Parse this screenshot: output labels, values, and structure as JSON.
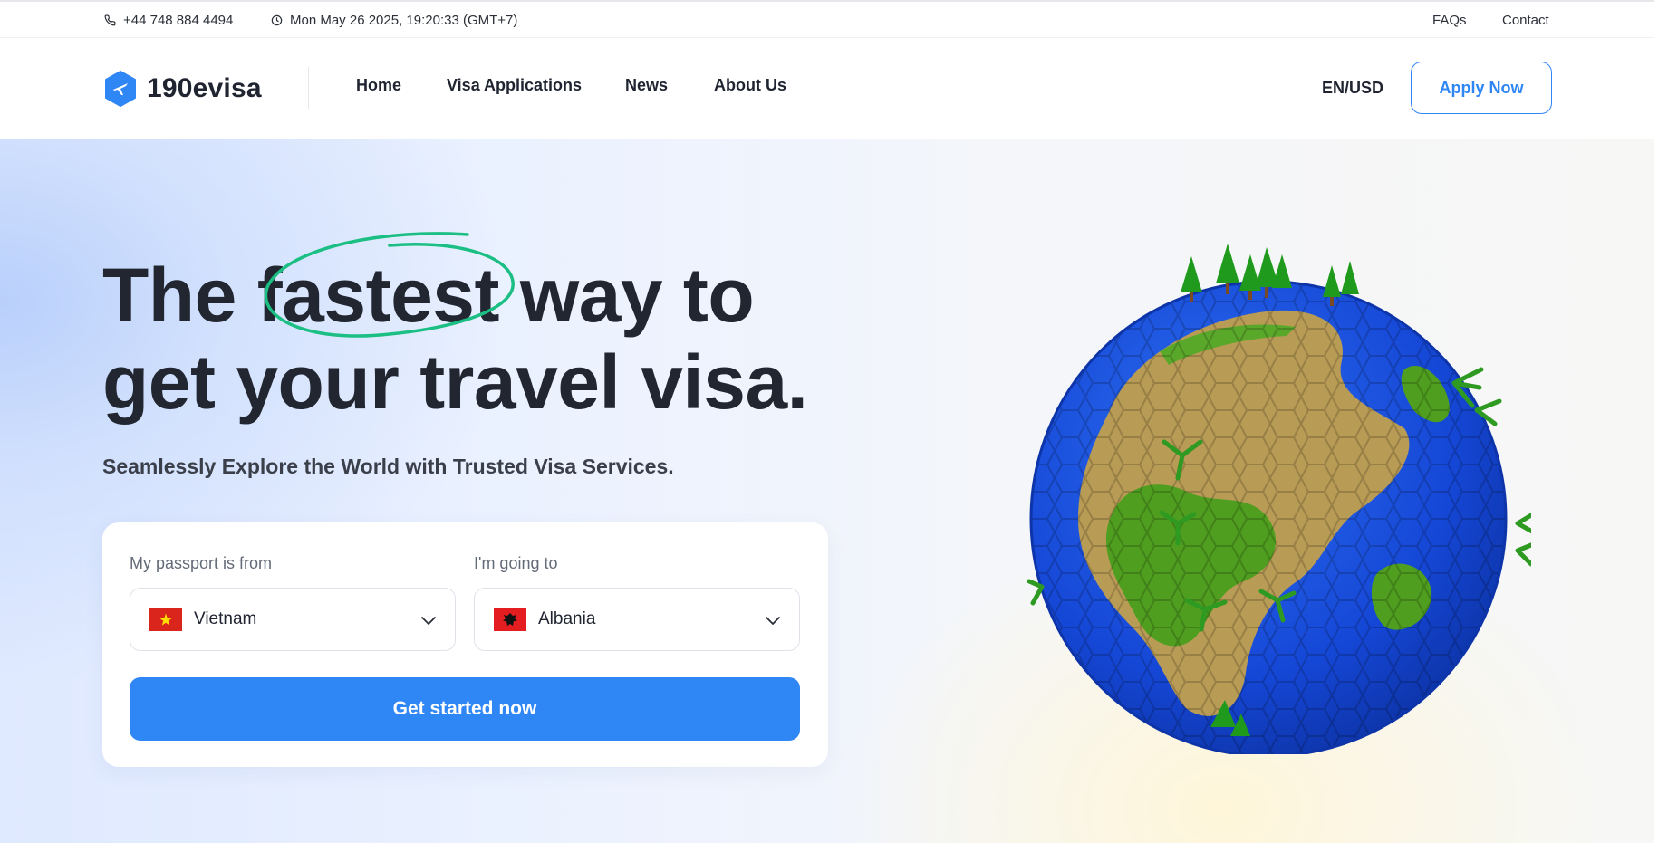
{
  "topbar": {
    "phone": "+44 748 884 4494",
    "datetime": "Mon May 26 2025, 19:20:33 (GMT+7)",
    "links": {
      "faqs": "FAQs",
      "contact": "Contact"
    }
  },
  "brand": {
    "name": "190evisa",
    "accent": "#2f86f5"
  },
  "nav": {
    "items": [
      "Home",
      "Visa Applications",
      "News",
      "About Us"
    ],
    "locale": "EN/USD",
    "apply_label": "Apply Now"
  },
  "hero": {
    "headline_part1": "The ",
    "headline_highlight": "fastest",
    "headline_part2": " way to",
    "headline_line2": "get your travel visa.",
    "subheadline": "Seamlessly Explore the World with Trusted Visa Services.",
    "highlight_color": "#1bbf83"
  },
  "form": {
    "passport_label": "My passport is from",
    "passport_value": "Vietnam",
    "destination_label": "I'm going to",
    "destination_value": "Albania",
    "submit_label": "Get started now"
  },
  "icons": {
    "phone": "phone-icon",
    "clock": "clock-icon",
    "logo": "airplane-badge-icon",
    "chevron": "chevron-down-icon"
  }
}
